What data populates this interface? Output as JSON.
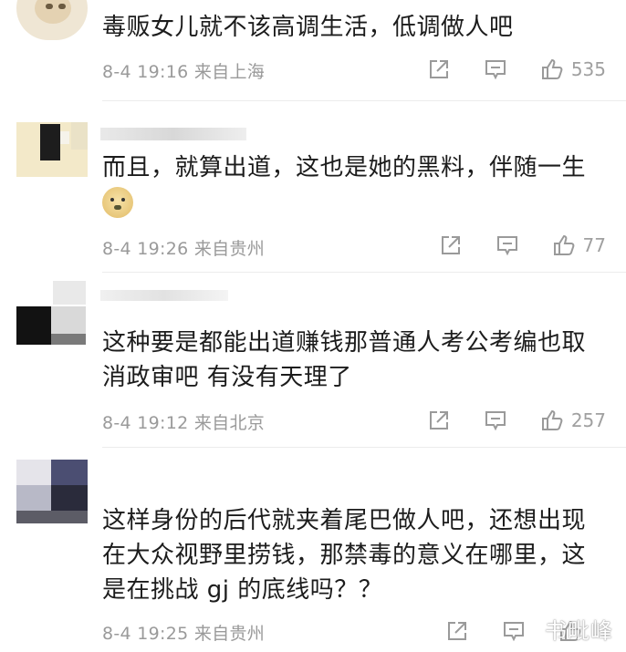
{
  "comments": [
    {
      "text": "毒贩女儿就不该高调生活，低调做人吧",
      "meta": "8-4 19:16 来自上海",
      "likes": "535"
    },
    {
      "text": "而且，就算出道，这也是她的黑料，伴随一生",
      "meta": "8-4 19:26 来自贵州",
      "likes": "77"
    },
    {
      "text": "这种要是都能出道赚钱那普通人考公考编也取消政审吧 有没有天理了",
      "meta": "8-4 19:12 来自北京",
      "likes": "257"
    },
    {
      "text": "这样身份的后代就夹着尾巴做人吧，还想出现在大众视野里捞钱，那禁毒的意义在哪里，这是在挑战 gj 的底线吗？？",
      "meta": "8-4 19:25 来自贵州",
      "likes": ""
    }
  ],
  "watermark": "书毗峰",
  "icons": {
    "share": "share-icon",
    "comment": "comment-icon",
    "like": "thumbs-up-icon",
    "emoji": "doge-emoji-icon"
  }
}
